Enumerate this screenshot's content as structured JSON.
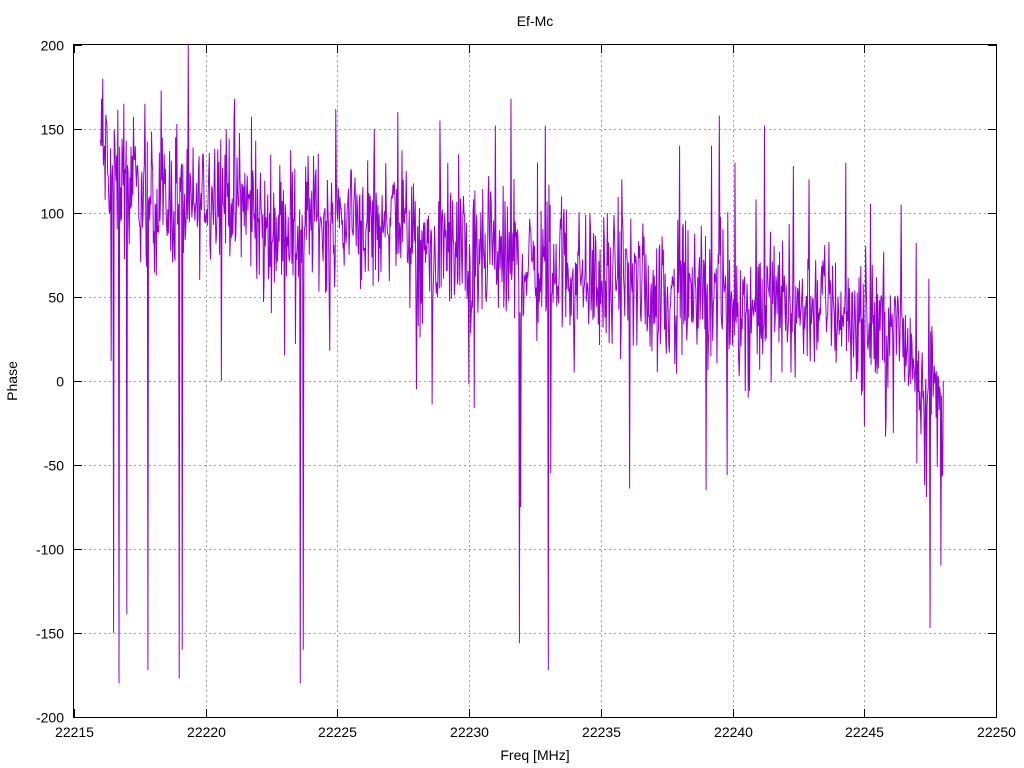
{
  "chart_data": {
    "type": "line",
    "title": "Ef-Mc",
    "xlabel": "Freq [MHz]",
    "ylabel": "Phase",
    "xlim": [
      22215,
      22250
    ],
    "ylim": [
      -200,
      200
    ],
    "xticks": [
      22215,
      22220,
      22225,
      22230,
      22235,
      22240,
      22245,
      22250
    ],
    "yticks": [
      -200,
      -150,
      -100,
      -50,
      0,
      50,
      100,
      150,
      200
    ],
    "grid": true,
    "line_color": "#9400d3",
    "series": [
      {
        "x_start": 22216.0,
        "x_end": 22248.0,
        "baseline_points": [
          [
            22216.0,
            140
          ],
          [
            22216.5,
            120
          ],
          [
            22217.0,
            115
          ],
          [
            22217.5,
            110
          ],
          [
            22218.0,
            108
          ],
          [
            22218.5,
            105
          ],
          [
            22219.0,
            110
          ],
          [
            22219.5,
            100
          ],
          [
            22220.0,
            112
          ],
          [
            22220.5,
            118
          ],
          [
            22221.0,
            110
          ],
          [
            22221.5,
            105
          ],
          [
            22222.0,
            95
          ],
          [
            22222.5,
            90
          ],
          [
            22223.0,
            95
          ],
          [
            22223.5,
            88
          ],
          [
            22224.0,
            100
          ],
          [
            22224.5,
            95
          ],
          [
            22225.0,
            92
          ],
          [
            22225.5,
            98
          ],
          [
            22226.0,
            95
          ],
          [
            22226.5,
            92
          ],
          [
            22227.0,
            100
          ],
          [
            22227.5,
            95
          ],
          [
            22228.0,
            75
          ],
          [
            22228.5,
            72
          ],
          [
            22229.0,
            80
          ],
          [
            22229.5,
            78
          ],
          [
            22230.0,
            65
          ],
          [
            22230.5,
            70
          ],
          [
            22231.0,
            72
          ],
          [
            22231.5,
            68
          ],
          [
            22232.0,
            70
          ],
          [
            22232.5,
            65
          ],
          [
            22233.0,
            68
          ],
          [
            22233.5,
            70
          ],
          [
            22234.0,
            62
          ],
          [
            22234.5,
            65
          ],
          [
            22235.0,
            55
          ],
          [
            22235.5,
            60
          ],
          [
            22236.0,
            58
          ],
          [
            22236.5,
            55
          ],
          [
            22237.0,
            52
          ],
          [
            22237.5,
            50
          ],
          [
            22238.0,
            55
          ],
          [
            22238.5,
            50
          ],
          [
            22239.0,
            52
          ],
          [
            22239.5,
            50
          ],
          [
            22240.0,
            48
          ],
          [
            22240.5,
            42
          ],
          [
            22241.0,
            45
          ],
          [
            22241.5,
            48
          ],
          [
            22242.0,
            45
          ],
          [
            22242.5,
            42
          ],
          [
            22243.0,
            45
          ],
          [
            22243.5,
            48
          ],
          [
            22244.0,
            42
          ],
          [
            22244.5,
            38
          ],
          [
            22245.0,
            35
          ],
          [
            22245.5,
            32
          ],
          [
            22246.0,
            30
          ],
          [
            22246.5,
            25
          ],
          [
            22247.0,
            10
          ],
          [
            22247.5,
            0
          ],
          [
            22248.0,
            -20
          ]
        ],
        "noise_amplitude": 35,
        "spikes": [
          [
            22216.1,
            180
          ],
          [
            22216.4,
            12
          ],
          [
            22216.5,
            -150
          ],
          [
            22216.7,
            -180
          ],
          [
            22216.9,
            165
          ],
          [
            22217.0,
            -139
          ],
          [
            22217.7,
            165
          ],
          [
            22217.8,
            -172
          ],
          [
            22218.3,
            173
          ],
          [
            22218.9,
            153
          ],
          [
            22219.0,
            -177
          ],
          [
            22219.1,
            -160
          ],
          [
            22220.6,
            0
          ],
          [
            22221.1,
            168
          ],
          [
            22221.9,
            143
          ],
          [
            22222.2,
            47
          ],
          [
            22223.4,
            22
          ],
          [
            22223.6,
            -180
          ],
          [
            22223.7,
            -160
          ],
          [
            22224.7,
            18
          ],
          [
            22226.4,
            150
          ],
          [
            22227.3,
            160
          ],
          [
            22228.0,
            -5
          ],
          [
            22228.6,
            -14
          ],
          [
            22228.9,
            155
          ],
          [
            22229.6,
            135
          ],
          [
            22230.0,
            -2
          ],
          [
            22230.2,
            -16
          ],
          [
            22231.0,
            152
          ],
          [
            22231.6,
            168
          ],
          [
            22231.9,
            -156
          ],
          [
            22231.95,
            -75
          ],
          [
            22232.6,
            130
          ],
          [
            22232.9,
            152
          ],
          [
            22233.0,
            -172
          ],
          [
            22233.1,
            -55
          ],
          [
            22233.5,
            110
          ],
          [
            22234.0,
            5
          ],
          [
            22235.8,
            120
          ],
          [
            22236.1,
            -64
          ],
          [
            22236.3,
            70
          ],
          [
            22238.0,
            140
          ],
          [
            22239.0,
            -65
          ],
          [
            22239.2,
            140
          ],
          [
            22239.5,
            158
          ],
          [
            22239.8,
            -56
          ],
          [
            22240.1,
            130
          ],
          [
            22240.6,
            -10
          ],
          [
            22241.2,
            152
          ],
          [
            22242.3,
            128
          ],
          [
            22242.9,
            120
          ],
          [
            22243.7,
            60
          ],
          [
            22244.3,
            130
          ],
          [
            22245.0,
            -27
          ],
          [
            22245.8,
            -33
          ],
          [
            22246.4,
            105
          ],
          [
            22247.0,
            -49
          ],
          [
            22247.3,
            -62
          ],
          [
            22247.5,
            -147
          ],
          [
            22247.6,
            20
          ],
          [
            22247.9,
            -110
          ],
          [
            22248.0,
            0
          ]
        ]
      }
    ]
  },
  "title": "Ef-Mc",
  "xlabel": "Freq [MHz]",
  "ylabel": "Phase",
  "xtick_labels": [
    "22215",
    "22220",
    "22225",
    "22230",
    "22235",
    "22240",
    "22245",
    "22250"
  ],
  "ytick_labels": [
    "-200",
    "-150",
    "-100",
    "-50",
    "0",
    "50",
    "100",
    "150",
    "200"
  ]
}
